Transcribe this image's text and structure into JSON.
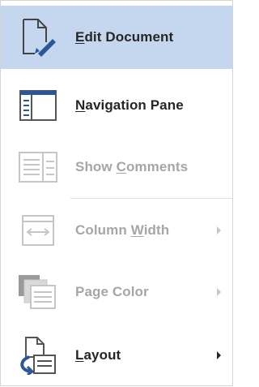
{
  "menu": {
    "items": [
      {
        "pre": "",
        "u": "E",
        "post": "dit Document"
      },
      {
        "pre": "",
        "u": "N",
        "post": "avigation Pane"
      },
      {
        "pre": "Show ",
        "u": "C",
        "post": "omments"
      },
      {
        "pre": "Column ",
        "u": "W",
        "post": "idth"
      },
      {
        "pre": "Page Color",
        "u": "",
        "post": ""
      },
      {
        "pre": "",
        "u": "L",
        "post": "ayout"
      }
    ]
  },
  "icons": [
    "edit-document-icon",
    "navigation-pane-icon",
    "show-comments-icon",
    "column-width-icon",
    "page-color-icon",
    "layout-icon"
  ],
  "colors": {
    "active_bg": "#c5d6ef",
    "accent_blue": "#2b579a",
    "text": "#262626",
    "disabled_text": "#a6a6a6"
  }
}
